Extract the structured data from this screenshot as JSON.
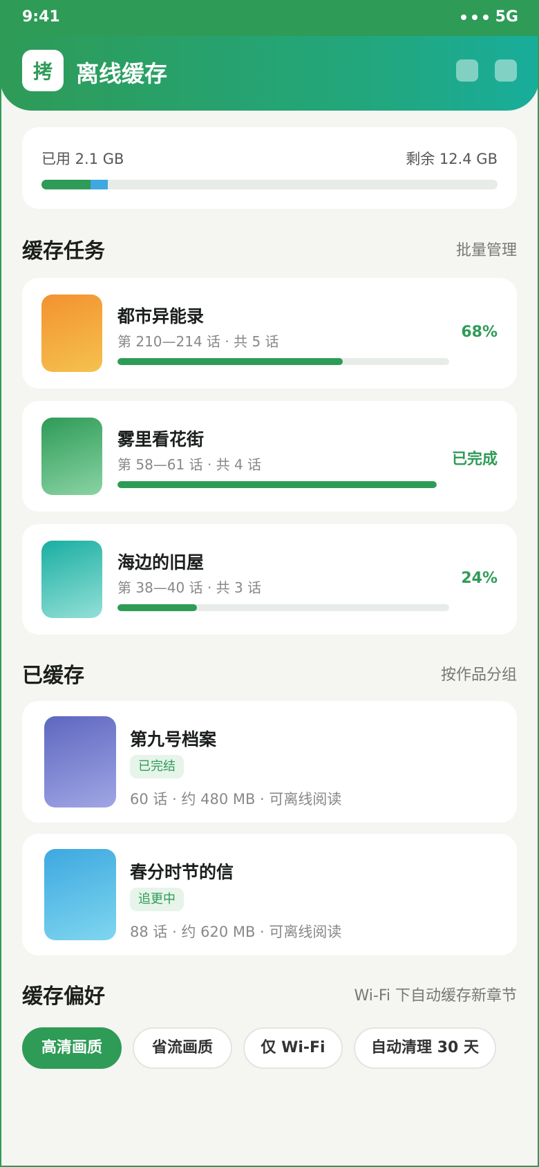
{
  "status_bar": {
    "time": "9:41",
    "network": "5G"
  },
  "header": {
    "logo_char": "拷",
    "title": "离线缓存"
  },
  "storage": {
    "used": "已用 2.1 GB",
    "remaining": "剩余 12.4 GB",
    "used_fraction": 0.146,
    "colors": {
      "primary": "#2e9b57",
      "secondary": "#3ea8e0"
    }
  },
  "tasks_section": {
    "title": "缓存任务",
    "action": "批量管理"
  },
  "tasks": [
    {
      "name": "都市异能录",
      "meta": "第 210—214 话 · 共 5 话",
      "progress": 0.68,
      "status": "68%"
    },
    {
      "name": "雾里看花街",
      "meta": "第 58—61 话 · 共 4 话",
      "progress": 1.0,
      "status": "已完成"
    },
    {
      "name": "海边的旧屋",
      "meta": "第 38—40 话 · 共 3 话",
      "progress": 0.24,
      "status": "24%"
    }
  ],
  "cached_section": {
    "title": "已缓存",
    "action": "按作品分组"
  },
  "cached": [
    {
      "name": "第九号档案",
      "badge": "已完结",
      "meta": "60 话 · 约 480 MB · 可离线阅读"
    },
    {
      "name": "春分时节的信",
      "badge": "追更中",
      "meta": "88 话 · 约 620 MB · 可离线阅读"
    }
  ],
  "prefs_section": {
    "title": "缓存偏好",
    "note": "Wi-Fi 下自动缓存新章节"
  },
  "chips": [
    {
      "label": "高清画质",
      "active": true
    },
    {
      "label": "省流画质",
      "active": false
    },
    {
      "label": "仅 Wi-Fi",
      "active": false
    },
    {
      "label": "自动清理 30 天",
      "active": false
    }
  ]
}
